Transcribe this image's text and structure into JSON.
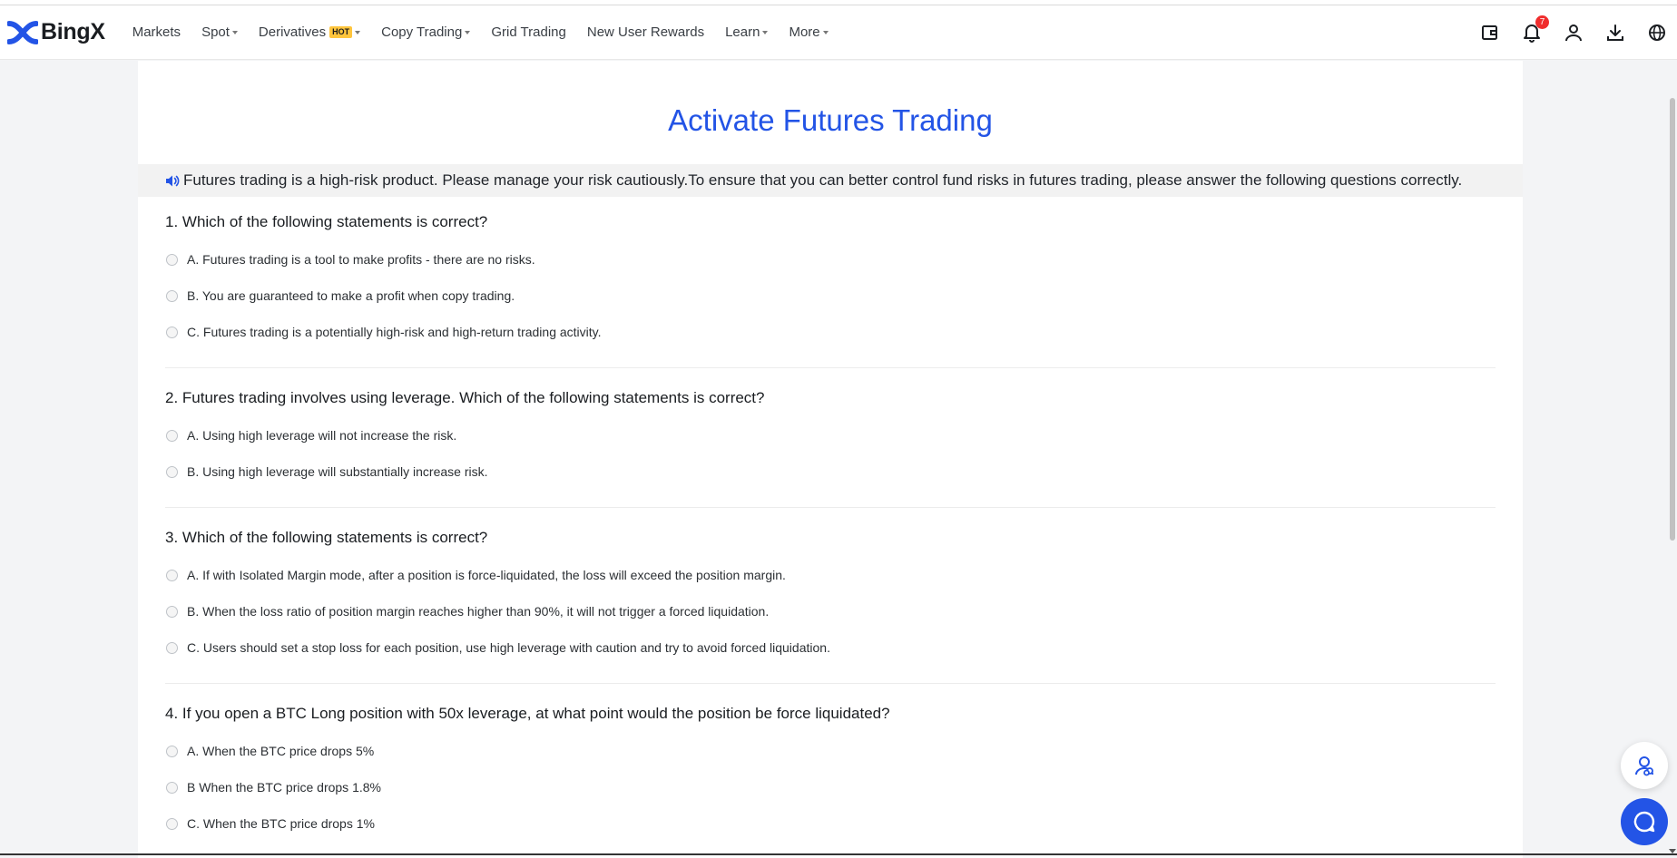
{
  "brand": {
    "name": "BingX",
    "accent": "#2354e6"
  },
  "nav": {
    "items": [
      {
        "label": "Markets",
        "dropdown": false
      },
      {
        "label": "Spot",
        "dropdown": true
      },
      {
        "label": "Derivatives",
        "badge": "HOT",
        "dropdown": true
      },
      {
        "label": "Copy Trading",
        "dropdown": true
      },
      {
        "label": "Grid Trading",
        "dropdown": false
      },
      {
        "label": "New User Rewards",
        "dropdown": false
      },
      {
        "label": "Learn",
        "dropdown": true
      },
      {
        "label": "More",
        "dropdown": true
      }
    ],
    "right_icons": [
      "wallet-icon",
      "bell-icon",
      "user-icon",
      "download-icon",
      "globe-icon"
    ],
    "notification_count": "7"
  },
  "page": {
    "title": "Activate Futures Trading",
    "notice": "Futures trading is a high-risk product. Please manage your risk cautiously.To ensure that you can better control fund risks in futures trading, please answer the following questions correctly."
  },
  "questions": [
    {
      "title": "1. Which of the following statements is correct?",
      "options": [
        "A. Futures trading is a tool to make profits - there are no risks.",
        "B. You are guaranteed to make a profit when copy trading.",
        "C. Futures trading is a potentially high-risk and high-return trading activity."
      ]
    },
    {
      "title": "2. Futures trading involves using leverage. Which of the following statements is correct?",
      "options": [
        "A. Using high leverage will not increase the risk.",
        "B. Using high leverage will substantially increase risk."
      ]
    },
    {
      "title": "3. Which of the following statements is correct?",
      "options": [
        "A. If with Isolated Margin mode, after a position is force-liquidated, the loss will exceed the position margin.",
        "B. When the loss ratio of position margin reaches higher than 90%, it will not trigger a forced liquidation.",
        "C. Users should set a stop loss for each position, use high leverage with caution and try to avoid forced liquidation."
      ]
    },
    {
      "title": "4. If you open a BTC Long position with 50x leverage, at what point would the position be force liquidated?",
      "options": [
        "A. When the BTC price drops 5%",
        "B When the BTC price drops 1.8%",
        "C. When the BTC price drops 1%"
      ]
    }
  ]
}
